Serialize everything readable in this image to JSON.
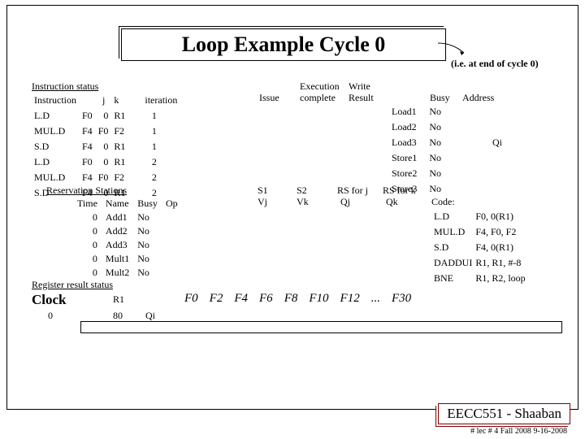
{
  "title": "Loop Example Cycle 0",
  "subtitle": "(i.e. at end of cycle 0)",
  "instr_status_hdr": "Instruction status",
  "instr_cols": {
    "instruction": "Instruction",
    "j": "j",
    "k": "k",
    "iteration": "iteration",
    "issue": "Issue",
    "exec_complete": "Execution complete",
    "write_result": "Write Result"
  },
  "instr_rows": [
    {
      "op": "L.D",
      "dest": "F0",
      "j": "0",
      "k": "R1",
      "iter": "1"
    },
    {
      "op": "MUL.D",
      "dest": "F4",
      "j": "F0",
      "k": "F2",
      "iter": "1"
    },
    {
      "op": "S.D",
      "dest": "F4",
      "j": "0",
      "k": "R1",
      "iter": "1"
    },
    {
      "op": "L.D",
      "dest": "F0",
      "j": "0",
      "k": "R1",
      "iter": "2"
    },
    {
      "op": "MUL.D",
      "dest": "F4",
      "j": "F0",
      "k": "F2",
      "iter": "2"
    },
    {
      "op": "S.D",
      "dest": "F4",
      "j": "0",
      "k": "R1",
      "iter": "2"
    }
  ],
  "load_store": {
    "busy": "Busy",
    "address": "Address",
    "rows": [
      {
        "name": "Load1",
        "busy": "No"
      },
      {
        "name": "Load2",
        "busy": "No"
      },
      {
        "name": "Load3",
        "busy": "No",
        "qi": "Qi"
      },
      {
        "name": "Store1",
        "busy": "No"
      },
      {
        "name": "Store2",
        "busy": "No"
      },
      {
        "name": "Store3",
        "busy": "No"
      }
    ]
  },
  "rs_hdr": "Reservation Stations",
  "rs_cols": {
    "time": "Time",
    "name": "Name",
    "busy": "Busy",
    "op": "Op",
    "s1": "S1",
    "vj": "Vj",
    "s2": "S2",
    "vk": "Vk",
    "rsj": "RS for j",
    "qj": "Qj",
    "rsk": "RS for k",
    "qk": "Qk"
  },
  "rs_rows": [
    {
      "time": "0",
      "name": "Add1",
      "busy": "No"
    },
    {
      "time": "0",
      "name": "Add2",
      "busy": "No"
    },
    {
      "time": "0",
      "name": "Add3",
      "busy": "No"
    },
    {
      "time": "0",
      "name": "Mult1",
      "busy": "No"
    },
    {
      "time": "0",
      "name": "Mult2",
      "busy": "No"
    }
  ],
  "code": {
    "hdr": "Code:",
    "rows": [
      {
        "op": "L.D",
        "args": "F0, 0(R1)"
      },
      {
        "op": "MUL.D",
        "args": "F4, F0, F2"
      },
      {
        "op": "S.D",
        "args": "F4, 0(R1)"
      },
      {
        "op": "DADDUI",
        "args": "R1, R1, #-8"
      },
      {
        "op": "BNE",
        "args": "R1, R2, loop"
      }
    ]
  },
  "reg_hdr": "Register result status",
  "clock_label": "Clock",
  "clock_val": "0",
  "r1_label": "R1",
  "r1_val": "80",
  "qi_label": "Qi",
  "regs": [
    "F0",
    "F2",
    "F4",
    "F6",
    "F8",
    "F10",
    "F12",
    "...",
    "F30"
  ],
  "footer": "EECC551 - Shaaban",
  "footer_small": "#  lec # 4   Fall 2008    9-16-2008"
}
